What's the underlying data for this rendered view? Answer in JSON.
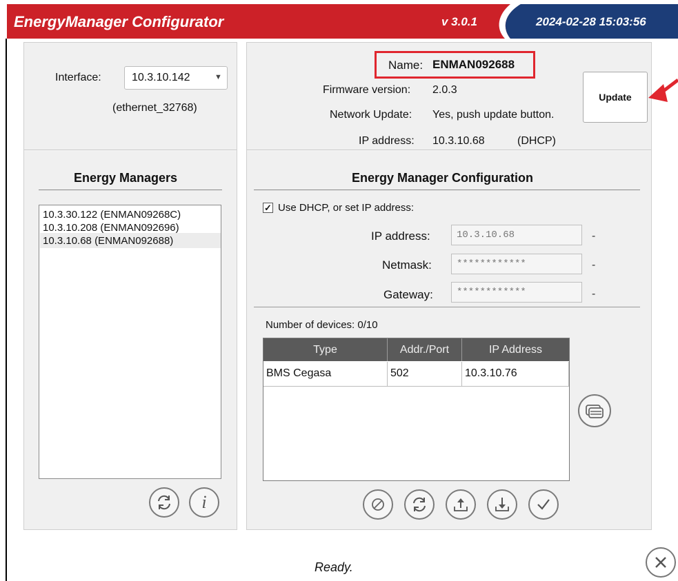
{
  "title_bar": {
    "app_name": "EnergyManager Configurator",
    "version": "v 3.0.1",
    "datetime": "2024-02-28 15:03:56",
    "colors": {
      "red": "#cc2128",
      "blue": "#1c3d78"
    }
  },
  "interface": {
    "label": "Interface:",
    "selected": "10.3.10.142",
    "adapter": "(ethernet_32768)"
  },
  "energy_managers": {
    "title": "Energy Managers",
    "items": [
      "10.3.30.122 (ENMAN09268C)",
      "10.3.10.208 (ENMAN092696)",
      "10.3.10.68 (ENMAN092688)"
    ],
    "buttons": {
      "refresh_icon": "refresh-icon",
      "info_icon": "info-icon"
    }
  },
  "device_info": {
    "name_label": "Name:",
    "name_value": "ENMAN092688",
    "firmware_label": "Firmware version:",
    "firmware_value": "2.0.3",
    "network_update_label": "Network Update:",
    "network_update_value": "Yes, push update button.",
    "ip_label": "IP address:",
    "ip_value": "10.3.10.68",
    "ip_mode": "(DHCP)",
    "update_button": "Update"
  },
  "config": {
    "title": "Energy Manager Configuration",
    "dhcp_checked": true,
    "dhcp_label": "Use DHCP, or set IP address:",
    "fields": {
      "ip": {
        "label": "IP address:",
        "value": "10.3.10.68"
      },
      "netmask": {
        "label": "Netmask:",
        "value": "************"
      },
      "gateway": {
        "label": "Gateway:",
        "value": "************"
      }
    },
    "dash": "-",
    "device_count": "Number of devices: 0/10",
    "table": {
      "headers": [
        "Type",
        "Addr./Port",
        "IP Address"
      ],
      "rows": [
        [
          "BMS Cegasa",
          "502",
          "10.3.10.76"
        ]
      ]
    }
  },
  "status": "Ready."
}
